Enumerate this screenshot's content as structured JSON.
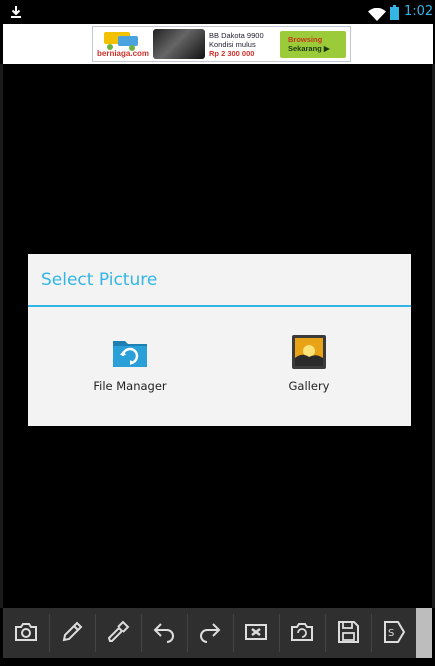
{
  "status_bar": {
    "time": "1:02",
    "icons": [
      "download-icon",
      "wifi-icon",
      "battery-icon"
    ],
    "accent_color": "#33b5e5"
  },
  "ad": {
    "brand": "berniaga.com",
    "headline": "BB Dakota 9900",
    "subline": "Kondisi mulus",
    "price": "Rp 2 300 000",
    "cta_line1": "Browsing",
    "cta_line2": "Sekarang ▶"
  },
  "dialog": {
    "title": "Select Picture",
    "options": [
      {
        "label": "File Manager",
        "icon": "folder-refresh-icon"
      },
      {
        "label": "Gallery",
        "icon": "gallery-icon"
      }
    ]
  },
  "toolbar": {
    "buttons": [
      "camera-icon",
      "pencil-icon",
      "eyedropper-icon",
      "undo-icon",
      "redo-icon",
      "clear-icon",
      "rotate-icon",
      "save-icon",
      "share-icon"
    ]
  }
}
